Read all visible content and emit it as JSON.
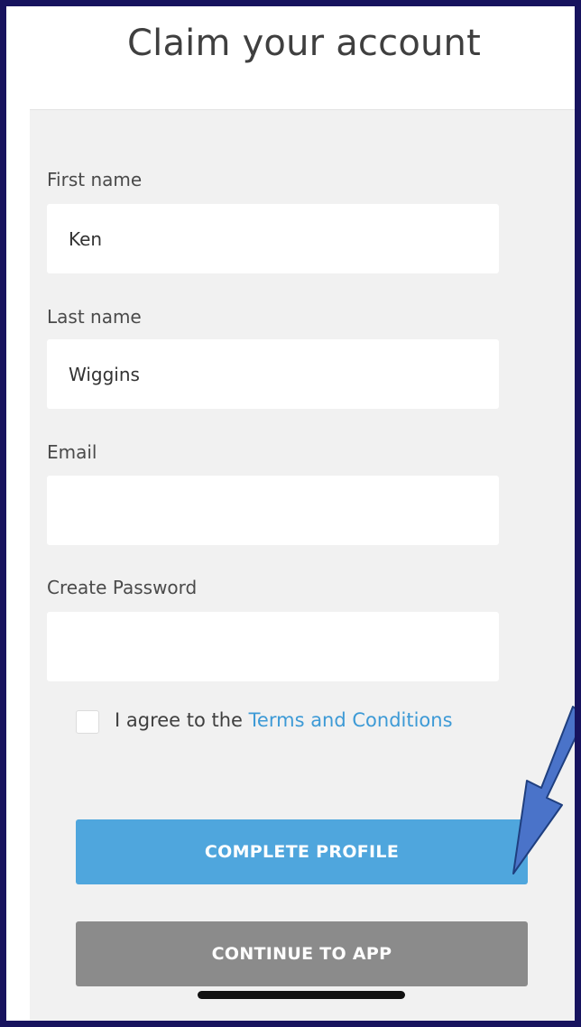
{
  "header": {
    "title": "Claim your account"
  },
  "form": {
    "first_name": {
      "label": "First name",
      "value": "Ken"
    },
    "last_name": {
      "label": "Last name",
      "value": "Wiggins"
    },
    "email": {
      "label": "Email",
      "value": ""
    },
    "password": {
      "label": "Create Password",
      "value": ""
    },
    "terms": {
      "prefix": "I agree to the",
      "link_text": "Terms and Conditions",
      "checked": false
    }
  },
  "buttons": {
    "complete_profile": "COMPLETE PROFILE",
    "continue_to_app": "CONTINUE TO APP"
  },
  "colors": {
    "frame_border": "#17135e",
    "primary_button": "#4fa6dd",
    "secondary_button": "#8b8b8b",
    "link": "#3d9ad6",
    "annotation_arrow": "#4a73c9"
  },
  "annotation": {
    "icon": "down-left-arrow-icon"
  }
}
